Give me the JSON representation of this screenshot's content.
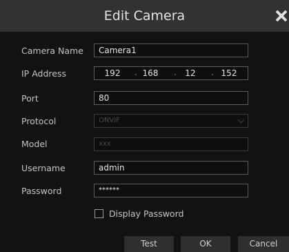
{
  "dialog": {
    "title": "Edit Camera"
  },
  "form": {
    "camera_name": {
      "label": "Camera Name",
      "value": "Camera1"
    },
    "ip_address": {
      "label": "IP Address",
      "octets": [
        "192",
        "168",
        "12",
        "152"
      ],
      "separator": "."
    },
    "port": {
      "label": "Port",
      "value": "80"
    },
    "protocol": {
      "label": "Protocol",
      "value": "ONVIF"
    },
    "model": {
      "label": "Model",
      "value": "xxx"
    },
    "username": {
      "label": "Username",
      "value": "admin"
    },
    "password": {
      "label": "Password",
      "value": "******"
    },
    "display_password": {
      "label": "Display Password",
      "checked": false
    }
  },
  "buttons": {
    "test": "Test",
    "ok": "OK",
    "cancel": "Cancel"
  },
  "colors": {
    "background": "#121212",
    "titlebar": "#323232",
    "field_border": "#5c5c5c",
    "button": "#2f2f2f"
  }
}
